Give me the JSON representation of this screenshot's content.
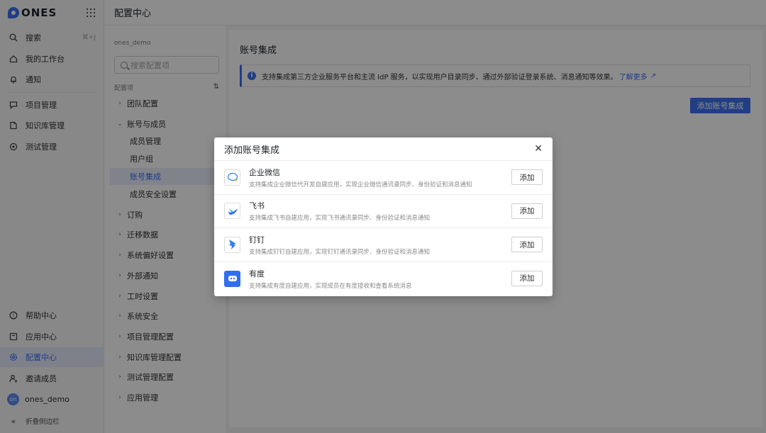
{
  "app": {
    "logo_text": "ONES"
  },
  "sidebar": {
    "top_items": [
      {
        "label": "搜索",
        "icon": "search-icon",
        "shortcut": "⌘+J"
      },
      {
        "label": "我的工作台",
        "icon": "home-icon"
      },
      {
        "label": "通知",
        "icon": "bell-icon"
      }
    ],
    "product_items": [
      {
        "label": "项目管理",
        "icon": "project-icon"
      },
      {
        "label": "知识库管理",
        "icon": "wiki-icon"
      },
      {
        "label": "测试管理",
        "icon": "test-icon"
      }
    ],
    "bottom_items": [
      {
        "label": "帮助中心",
        "icon": "help-icon"
      },
      {
        "label": "应用中心",
        "icon": "app-center-icon"
      },
      {
        "label": "配置中心",
        "icon": "settings-icon",
        "active": true
      },
      {
        "label": "邀请成员",
        "icon": "invite-user-icon"
      }
    ],
    "user": {
      "avatar_text": "on",
      "name": "ones_demo"
    },
    "collapse_label": "折叠侧边栏"
  },
  "header": {
    "title": "配置中心"
  },
  "settings_nav": {
    "org_name": "ones_demo",
    "search_placeholder": "搜索配置项",
    "section_label": "配置项",
    "items": [
      {
        "label": "团队配置",
        "expanded": false
      },
      {
        "label": "账号与成员",
        "expanded": true,
        "children": [
          {
            "label": "成员管理"
          },
          {
            "label": "用户组"
          },
          {
            "label": "账号集成",
            "active": true
          },
          {
            "label": "成员安全设置"
          }
        ]
      },
      {
        "label": "订购"
      },
      {
        "label": "迁移数据"
      },
      {
        "label": "系统偏好设置"
      },
      {
        "label": "外部通知"
      },
      {
        "label": "工时设置"
      },
      {
        "label": "系统安全"
      },
      {
        "label": "项目管理配置"
      },
      {
        "label": "知识库管理配置"
      },
      {
        "label": "测试管理配置"
      },
      {
        "label": "应用管理"
      }
    ]
  },
  "main": {
    "title": "账号集成",
    "info_text": "支持集成第三方企业服务平台和主流 IdP 服务，以实现用户目录同步、通过外部验证登录系统、消息通知等效果。",
    "info_link": "了解更多",
    "add_button": "添加账号集成"
  },
  "modal": {
    "title": "添加账号集成",
    "close_icon": "close-icon",
    "rows": [
      {
        "name": "企业微信",
        "desc": "支持集成企业微信代开发自建应用，实现企业微信通讯录同步、身份验证和消息通知",
        "button": "添加",
        "icon": "wecom-icon"
      },
      {
        "name": "飞书",
        "desc": "支持集成飞书自建应用，实现飞书通讯录同步、身份验证和消息通知",
        "button": "添加",
        "icon": "feishu-icon"
      },
      {
        "name": "钉钉",
        "desc": "支持集成钉钉自建应用，实现钉钉通讯录同步、身份验证和消息通知",
        "button": "添加",
        "icon": "dingtalk-icon"
      },
      {
        "name": "有度",
        "desc": "支持集成有度自建应用，实现成员在有度接收和查看系统消息",
        "button": "添加",
        "icon": "youdu-icon"
      }
    ]
  },
  "colors": {
    "accent": "#3d6ff5"
  }
}
